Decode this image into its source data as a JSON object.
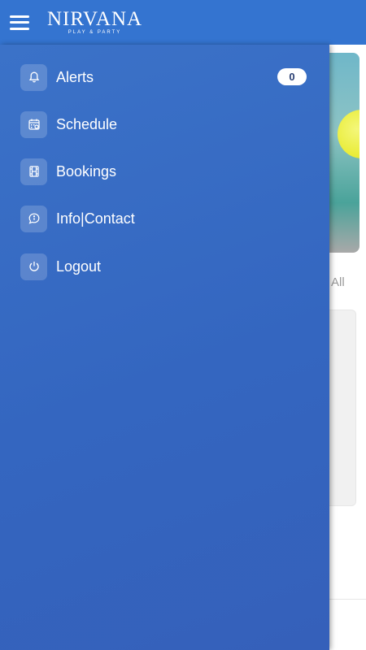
{
  "header": {
    "logo_title": "NIRVANA",
    "logo_subtitle": "PLAY & PARTY",
    "menu_icon": "hamburger-menu-icon",
    "background_color": "#3474d0"
  },
  "drawer": {
    "background_color": "#3566c0",
    "items": [
      {
        "label": "Alerts",
        "icon": "bell-icon",
        "badge": "0"
      },
      {
        "label": "Schedule",
        "icon": "calendar-icon"
      },
      {
        "label": "Bookings",
        "icon": "film-icon"
      },
      {
        "label": "Info|Contact",
        "icon": "chat-info-icon"
      },
      {
        "label": "Logout",
        "icon": "power-icon"
      }
    ]
  },
  "background_page": {
    "filter_label": "All"
  }
}
